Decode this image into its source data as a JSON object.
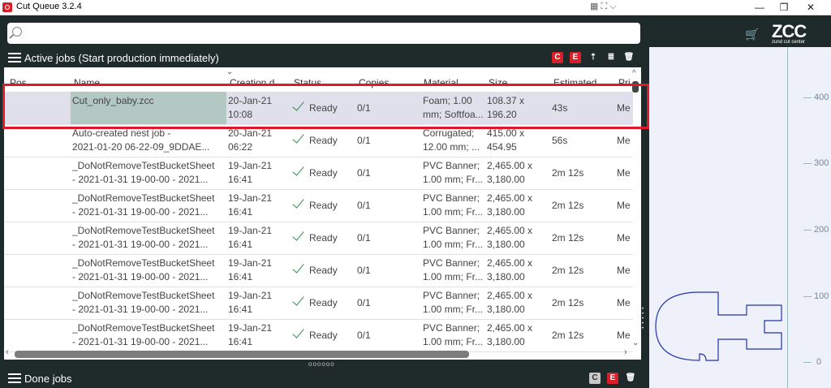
{
  "window": {
    "title": "Cut Queue 3.2.4",
    "minimize": "—",
    "maximize": "❐",
    "close": "✕"
  },
  "search": {
    "placeholder": ""
  },
  "active_jobs": {
    "title": "Active jobs (Start production immediately)"
  },
  "done_jobs": {
    "title": "Done jobs"
  },
  "brand": {
    "logo": "ZCC",
    "sub": "zund cut center"
  },
  "columns": [
    "Pos",
    "Name",
    "Creation d",
    "Status",
    "Copies",
    "Material",
    "Size",
    "Estimated",
    "Pri"
  ],
  "rows": [
    {
      "name1": "Cut_only_baby.zcc",
      "name2": "",
      "date1": "20-Jan-21",
      "date2": "10:08",
      "status": "Ready",
      "copies": "0/1",
      "mat1": "Foam; 1.00",
      "mat2": "mm; Softfoa...",
      "size1": "108.37 x",
      "size2": "196.20",
      "est": "43s",
      "pri": "Me"
    },
    {
      "name1": "Auto-created nest job -",
      "name2": "2021-01-20 06-22-09_9DDAE...",
      "date1": "20-Jan-21",
      "date2": "06:22",
      "status": "Ready",
      "copies": "0/1",
      "mat1": "Corrugated;",
      "mat2": "12.00 mm; ...",
      "size1": "415.00 x",
      "size2": "454.95",
      "est": "56s",
      "pri": "Me"
    },
    {
      "name1": "_DoNotRemoveTestBucketSheet",
      "name2": "- 2021-01-31 19-00-00 - 2021...",
      "date1": "19-Jan-21",
      "date2": "16:41",
      "status": "Ready",
      "copies": "0/1",
      "mat1": "PVC Banner;",
      "mat2": "1.00 mm; Fr...",
      "size1": "2,465.00 x",
      "size2": "3,180.00",
      "est": "2m 12s",
      "pri": "Me"
    },
    {
      "name1": "_DoNotRemoveTestBucketSheet",
      "name2": "- 2021-01-31 19-00-00 - 2021...",
      "date1": "19-Jan-21",
      "date2": "16:41",
      "status": "Ready",
      "copies": "0/1",
      "mat1": "PVC Banner;",
      "mat2": "1.00 mm; Fr...",
      "size1": "2,465.00 x",
      "size2": "3,180.00",
      "est": "2m 12s",
      "pri": "Me"
    },
    {
      "name1": "_DoNotRemoveTestBucketSheet",
      "name2": "- 2021-01-31 19-00-00 - 2021...",
      "date1": "19-Jan-21",
      "date2": "16:41",
      "status": "Ready",
      "copies": "0/1",
      "mat1": "PVC Banner;",
      "mat2": "1.00 mm; Fr...",
      "size1": "2,465.00 x",
      "size2": "3,180.00",
      "est": "2m 12s",
      "pri": "Me"
    },
    {
      "name1": "_DoNotRemoveTestBucketSheet",
      "name2": "- 2021-01-31 19-00-00 - 2021...",
      "date1": "19-Jan-21",
      "date2": "16:41",
      "status": "Ready",
      "copies": "0/1",
      "mat1": "PVC Banner;",
      "mat2": "1.00 mm; Fr...",
      "size1": "2,465.00 x",
      "size2": "3,180.00",
      "est": "2m 12s",
      "pri": "Me"
    },
    {
      "name1": "_DoNotRemoveTestBucketSheet",
      "name2": "- 2021-01-31 19-00-00 - 2021...",
      "date1": "19-Jan-21",
      "date2": "16:41",
      "status": "Ready",
      "copies": "0/1",
      "mat1": "PVC Banner;",
      "mat2": "1.00 mm; Fr...",
      "size1": "2,465.00 x",
      "size2": "3,180.00",
      "est": "2m 12s",
      "pri": "Me"
    },
    {
      "name1": "_DoNotRemoveTestBucketSheet",
      "name2": "- 2021-01-31 19-00-00 - 2021...",
      "date1": "19-Jan-21",
      "date2": "16:41",
      "status": "Ready",
      "copies": "0/1",
      "mat1": "PVC Banner;",
      "mat2": "1.00 mm; Fr...",
      "size1": "2,465.00 x",
      "size2": "3,180.00",
      "est": "2m 12s",
      "pri": "Me"
    }
  ],
  "ruler": [
    "400",
    "300",
    "200",
    "100",
    "0"
  ],
  "colors": {
    "accent_red": "#d9202a",
    "dark_bg": "#1f2b2b",
    "selected_row": "#dfe0ec",
    "check_green": "#2f8a4d"
  }
}
